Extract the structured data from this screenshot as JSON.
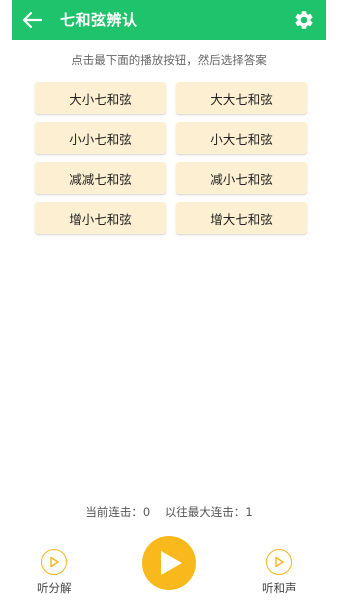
{
  "header": {
    "title": "七和弦辨认",
    "back_icon": "arrow-left-icon",
    "settings_icon": "gear-icon",
    "bar_color": "#1fc36b"
  },
  "instruction": "点击最下面的播放按钮，然后选择答案",
  "options": [
    "大小七和弦",
    "大大七和弦",
    "小小七和弦",
    "小大七和弦",
    "减减七和弦",
    "减小七和弦",
    "增小七和弦",
    "增大七和弦"
  ],
  "streak": {
    "current_label": "当前连击：",
    "current_value": "0",
    "best_label": "以往最大连击：",
    "best_value": "1"
  },
  "controls": {
    "analyze_label": "听分解",
    "chord_label": "听和声",
    "play_icon": "play-icon",
    "accent_color": "#f9b91d"
  }
}
